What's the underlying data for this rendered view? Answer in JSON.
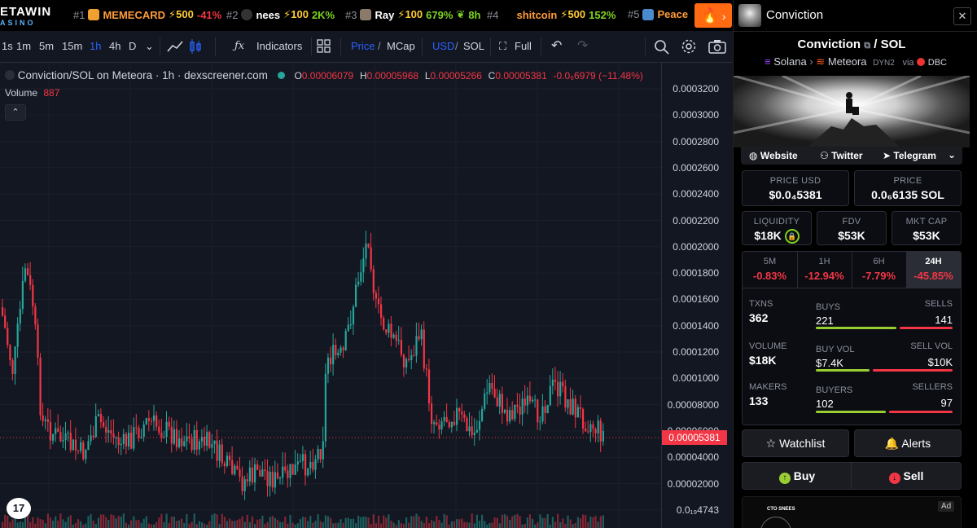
{
  "brand": {
    "line1": "ETAWIN",
    "line2": "ASINO"
  },
  "trending": [
    {
      "rank": "#1",
      "name": "MEMECARD",
      "boost": "⚡500",
      "change": "-41%",
      "change_color": "#f23645",
      "name_color": "#ff9d3b"
    },
    {
      "rank": "#2",
      "name": "nees",
      "boost": "⚡100",
      "change": "2K%",
      "change_color": "#7ed321",
      "name_color": "#ffffff"
    },
    {
      "rank": "#3",
      "name": "Ray",
      "boost": "⚡100",
      "change": "679%",
      "change_color": "#7ed321",
      "name_color": "#ffffff",
      "age": "8h"
    },
    {
      "rank": "#4",
      "name": "shitcoin",
      "boost": "⚡500",
      "change": "152%",
      "change_color": "#7ed321",
      "name_color": "#ff9d3b"
    },
    {
      "rank": "#5",
      "name": "Peace",
      "boost": "",
      "change": "",
      "change_color": "#7ed321",
      "name_color": "#ff9d3b"
    }
  ],
  "toolbar": {
    "intervals": [
      "1s",
      "1m",
      "5m",
      "15m",
      "1h",
      "4h",
      "D"
    ],
    "active_interval": "1h",
    "indicators": "Indicators",
    "price": "Price",
    "mcap": "MCap",
    "usd": "USD",
    "sol": "SOL",
    "full": "Full"
  },
  "legend": {
    "pair": "Conviction/SOL on Meteora · 1h · dexscreener.com",
    "o_label": "O",
    "o": "0.00006079",
    "h_label": "H",
    "h": "0.00005968",
    "l_label": "L",
    "l": "0.00005266",
    "c_label": "C",
    "c": "0.00005381",
    "change": "-0.0₆6979 (−11.48%)",
    "volume_label": "Volume",
    "volume": "887"
  },
  "price_axis": [
    "0.0003200",
    "0.0003000",
    "0.0002800",
    "0.0002600",
    "0.0002400",
    "0.0002200",
    "0.0002000",
    "0.0001800",
    "0.0001600",
    "0.0001400",
    "0.0001200",
    "0.0001000",
    "0.00008000",
    "0.00006000",
    "0.00004000",
    "0.00002000",
    "0.0₁₉4743"
  ],
  "current_price": "0.00005381",
  "tv_logo": "17",
  "panel": {
    "header_name": "Conviction",
    "title": "Conviction",
    "quote": "SOL",
    "chain": "Solana",
    "dex": "Meteora",
    "dex_tag": "DYN2",
    "via": "via",
    "via_name": "DBC",
    "links": [
      "Website",
      "Twitter",
      "Telegram"
    ],
    "price_usd_label": "PRICE USD",
    "price_usd": "$0.0₄5381",
    "price_sol_label": "PRICE",
    "price_sol": "0.0₆6135 SOL",
    "liquidity_label": "LIQUIDITY",
    "liquidity": "$18K",
    "fdv_label": "FDV",
    "fdv": "$53K",
    "mktcap_label": "MKT CAP",
    "mktcap": "$53K",
    "periods": [
      {
        "label": "5M",
        "value": "-0.83%"
      },
      {
        "label": "1H",
        "value": "-12.94%"
      },
      {
        "label": "6H",
        "value": "-7.79%"
      },
      {
        "label": "24H",
        "value": "-45.85%"
      }
    ],
    "txns_label": "TXNS",
    "txns": "362",
    "buys_label": "BUYS",
    "buys": "221",
    "sells_label": "SELLS",
    "sells": "141",
    "volume_label": "VOLUME",
    "volume": "$18K",
    "buyvol_label": "BUY VOL",
    "buyvol": "$7.4K",
    "sellvol_label": "SELL VOL",
    "sellvol": "$10K",
    "makers_label": "MAKERS",
    "makers": "133",
    "buyers_label": "BUYERS",
    "buyers": "102",
    "sellers_label": "SELLERS",
    "sellers": "97",
    "watchlist": "Watchlist",
    "alerts": "Alerts",
    "buy": "Buy",
    "sell": "Sell",
    "ad": "Ad",
    "ad_text": "CTO SNEES"
  },
  "colors": {
    "up": "#26a69a",
    "down": "#f23645",
    "accent": "#2962ff"
  }
}
